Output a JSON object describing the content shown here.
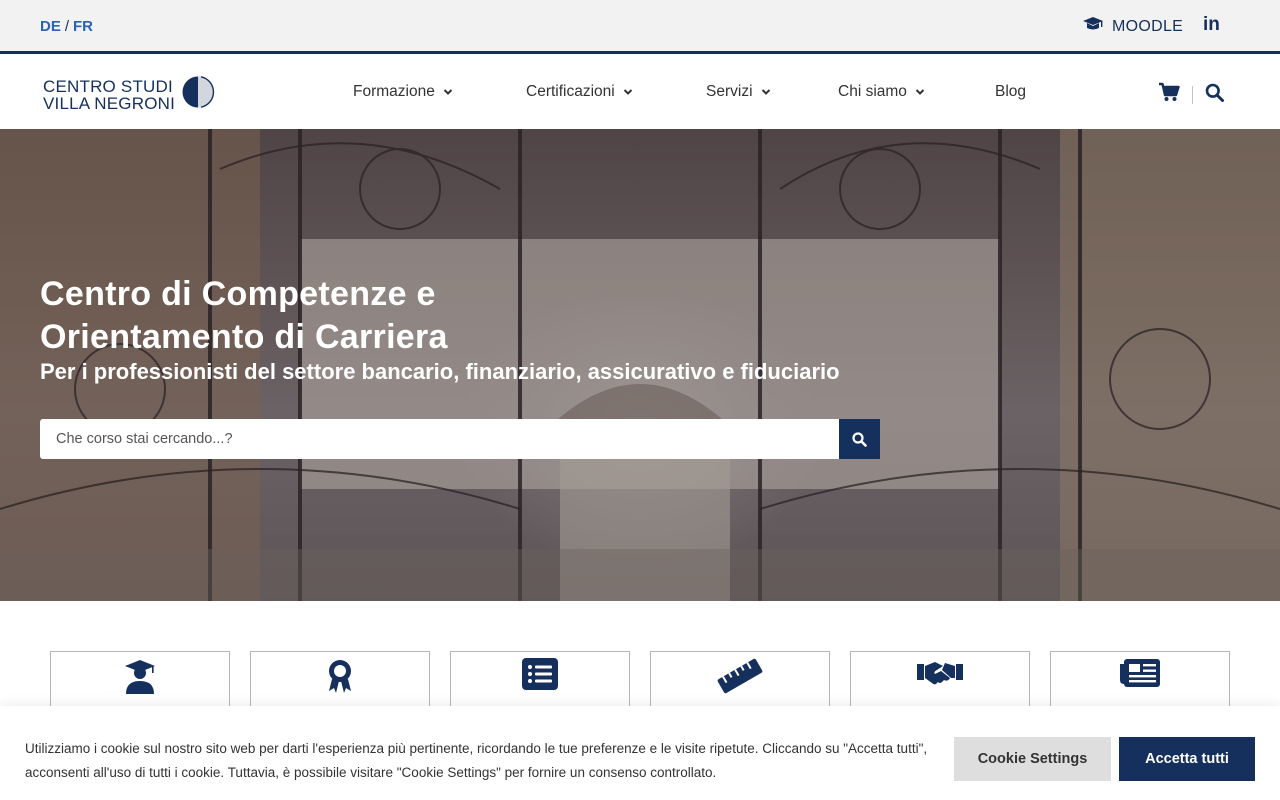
{
  "topbar": {
    "lang_de": "DE",
    "lang_sep": "/",
    "lang_fr": "FR",
    "moodle_label": "MOODLE",
    "linkedin_label": "in"
  },
  "logo": {
    "line1": "CENTRO STUDI",
    "line2": "VILLA NEGRONI"
  },
  "nav": {
    "items": [
      {
        "label": "Formazione",
        "dropdown": true
      },
      {
        "label": "Certificazioni",
        "dropdown": true
      },
      {
        "label": "Servizi",
        "dropdown": true
      },
      {
        "label": "Chi siamo",
        "dropdown": true
      },
      {
        "label": "Blog",
        "dropdown": false
      }
    ],
    "icons": [
      "cart-icon",
      "search-icon"
    ]
  },
  "hero": {
    "title": "Centro di Competenze e Orientamento di Carriera",
    "subtitle": "Per i professionisti del settore bancario, finanziario, assicurativo e fiduciario",
    "search_placeholder": "Che corso stai cercando...?"
  },
  "categories": {
    "icons": [
      "graduate-icon",
      "award-ribbon-icon",
      "list-icon",
      "ruler-icon",
      "handshake-icon",
      "newspaper-icon"
    ]
  },
  "cookie": {
    "text": "Utilizziamo i cookie sul nostro sito web per darti l'esperienza più pertinente, ricordando le tue preferenze e le visite ripetute. Cliccando su \"Accetta tutti\", acconsenti all'uso di tutti i cookie. Tuttavia, è possibile visitare \"Cookie Settings\" per fornire un consenso controllato.",
    "settings_label": "Cookie Settings",
    "accept_label": "Accetta tutti"
  },
  "colors": {
    "brand_navy": "#15305c",
    "link_blue": "#2a62b5",
    "button_grey": "#dedede"
  }
}
